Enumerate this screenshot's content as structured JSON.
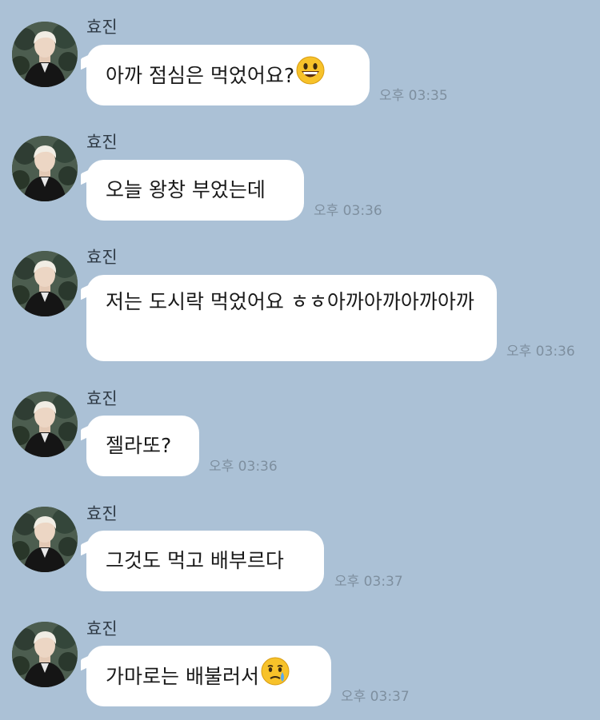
{
  "messages": [
    {
      "sender": "효진",
      "text": "아까 점심은 먹었어요?",
      "emoji": "grinning-face-icon",
      "time": "오후 03:35"
    },
    {
      "sender": "효진",
      "text": "오늘 왕창 부었는데",
      "time": "오후 03:36"
    },
    {
      "sender": "효진",
      "text": "저는 도시락 먹었어요 ㅎㅎ아까아까아까아까",
      "time": "오후 03:36"
    },
    {
      "sender": "효진",
      "text": "젤라또?",
      "time": "오후 03:36"
    },
    {
      "sender": "효진",
      "text": "그것도 먹고 배부르다",
      "time": "오후 03:37"
    },
    {
      "sender": "효진",
      "text": "가마로는 배불러서",
      "emoji": "crying-face-icon",
      "time": "오후 03:37"
    }
  ],
  "colors": {
    "background": "#abc1d6",
    "bubble": "#ffffff",
    "time_text": "#7e8f9f",
    "emoji_yellow": "#f7c22a",
    "tear_blue": "#5aa9ee"
  }
}
